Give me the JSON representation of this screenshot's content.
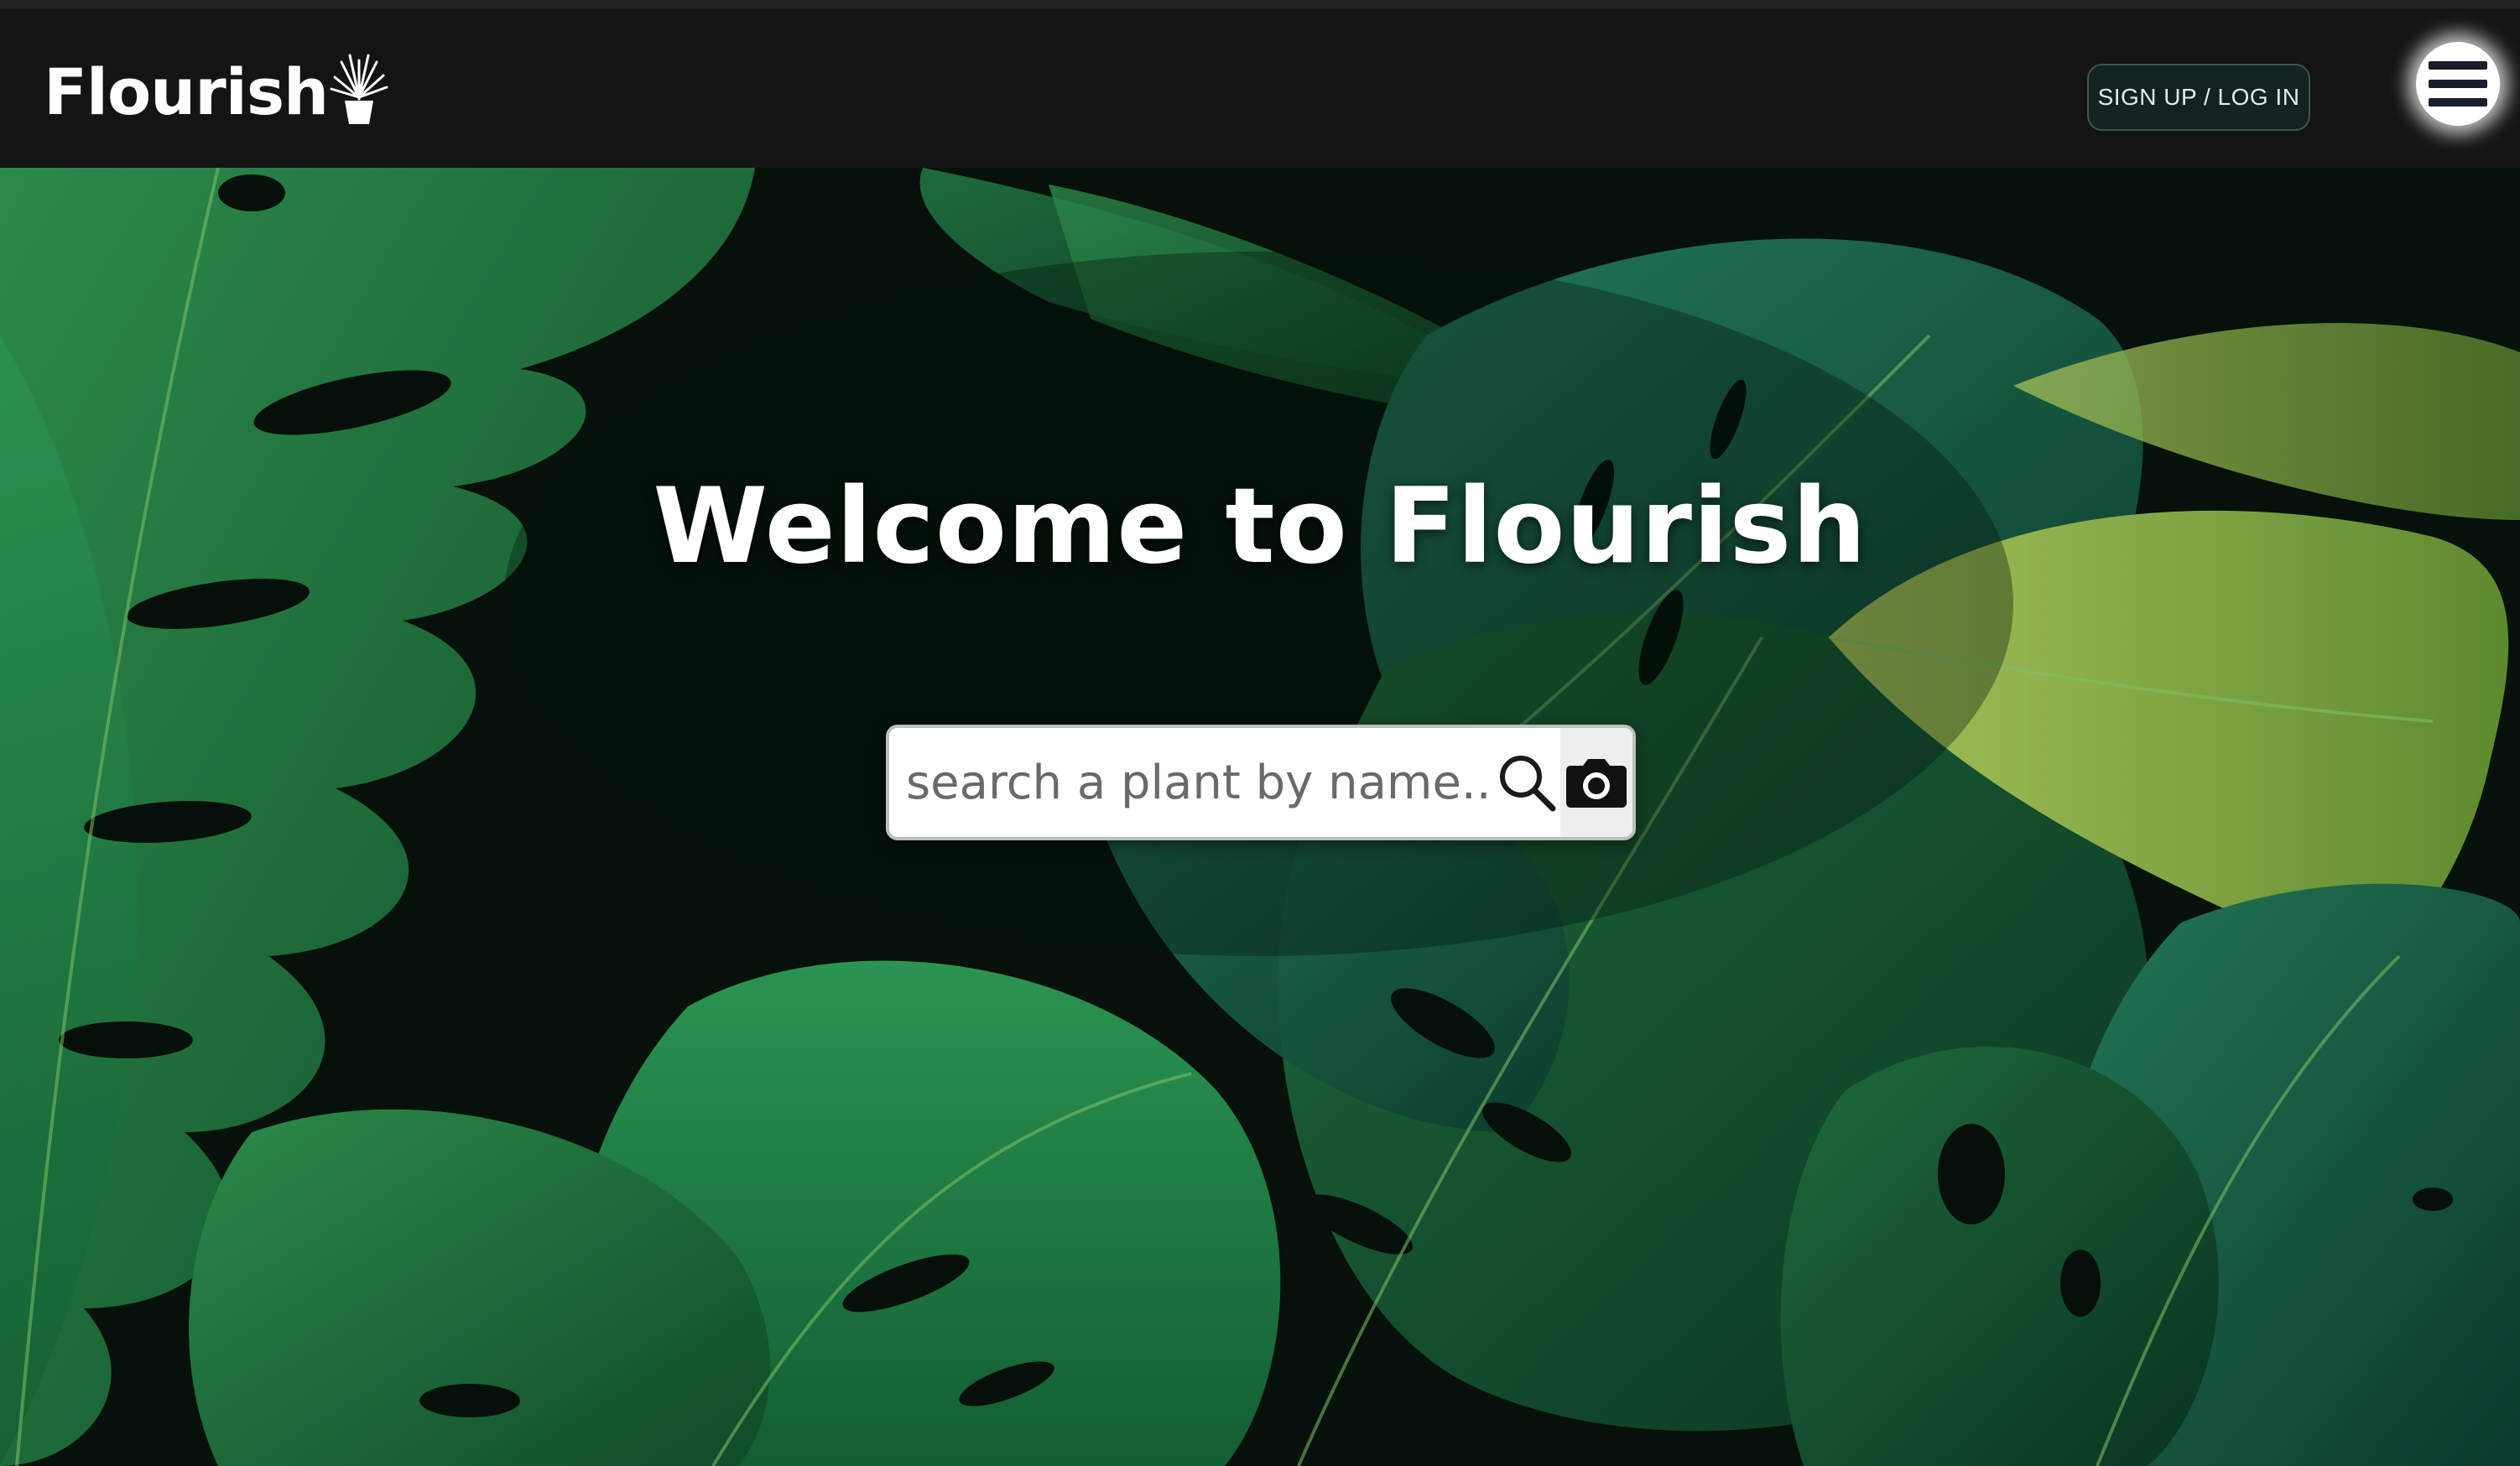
{
  "header": {
    "brand_name": "Flourish",
    "signup_label": "SIGN UP / LOG IN"
  },
  "hero": {
    "title": "Welcome to Flourish",
    "search_placeholder": "search a plant by name..."
  },
  "icons": {
    "logo": "potted-plant-icon",
    "menu": "hamburger-menu-icon",
    "search": "magnifier-icon",
    "camera": "camera-icon"
  },
  "colors": {
    "topbar_bg": "#141414",
    "signup_bg": "#122321",
    "foliage_dark": "#061510",
    "foliage_green": "#1f6e3c",
    "foliage_light": "#8fb04a"
  }
}
